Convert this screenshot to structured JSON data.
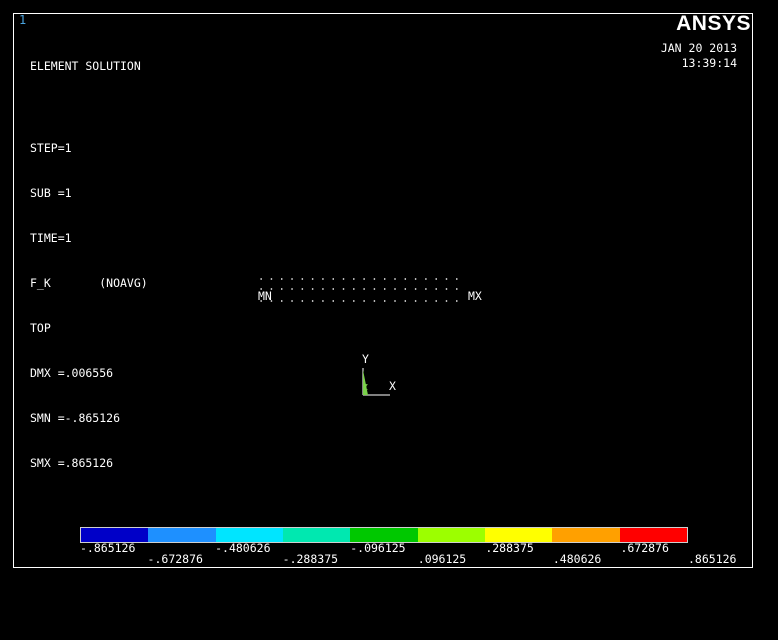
{
  "window_number": "1",
  "logo": "ANSYS",
  "date": "JAN 20 2013",
  "time": "13:39:14",
  "info": {
    "title": "ELEMENT SOLUTION",
    "step": "STEP=1",
    "sub": "SUB =1",
    "time": "TIME=1",
    "item": "F_K       (NOAVG)",
    "layer": "TOP",
    "dmx": "DMX =.006556",
    "smn": "SMN =-.865126",
    "smx": "SMX =.865126"
  },
  "model": {
    "min_label": "MN",
    "max_label": "MX",
    "node_rows": 3
  },
  "triad": {
    "x_label": "X",
    "y_label": "Y",
    "z_label": "Z",
    "x_color": "#ffffff",
    "y_color": "#ffffff",
    "z_color": "#7ad14a"
  },
  "legend": {
    "colors": [
      "#0000c8",
      "#1e90ff",
      "#00e5ff",
      "#00e8b0",
      "#00c800",
      "#9cff00",
      "#ffff00",
      "#ffa000",
      "#ff0000"
    ],
    "labels_top": [
      "-.865126",
      "-.480626",
      "-.096125",
      ".288375",
      ".672876"
    ],
    "labels_bottom": [
      "-.672876",
      "-.288375",
      ".096125",
      ".480626",
      ".865126"
    ]
  }
}
